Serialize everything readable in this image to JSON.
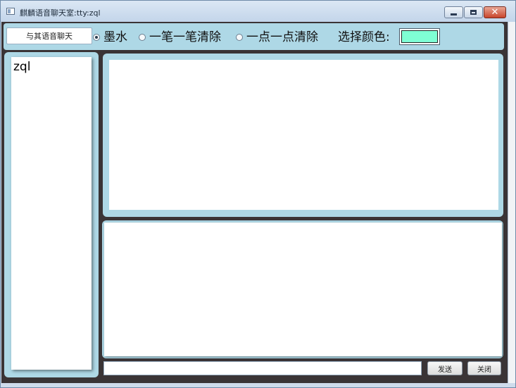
{
  "window": {
    "title": "麒麟语音聊天室:tty:zql",
    "controls": {
      "minimize_icon": "minimize-icon",
      "maximize_icon": "maximize-icon",
      "close_glyph": "✕"
    }
  },
  "toolbar": {
    "voice_chat_button": "与其语音聊天",
    "modes": [
      {
        "label": "墨水",
        "checked": true
      },
      {
        "label": "一笔一笔清除",
        "checked": false
      },
      {
        "label": "一点一点清除",
        "checked": false
      }
    ],
    "color_label": "选择颜色:",
    "selected_color": "#7fffd4"
  },
  "users": {
    "items": [
      "zql"
    ]
  },
  "compose": {
    "input_value": "",
    "send_label": "发送",
    "close_label": "关闭"
  },
  "theme": {
    "panel_color": "#aed8e6",
    "background_color": "#3a3436"
  }
}
